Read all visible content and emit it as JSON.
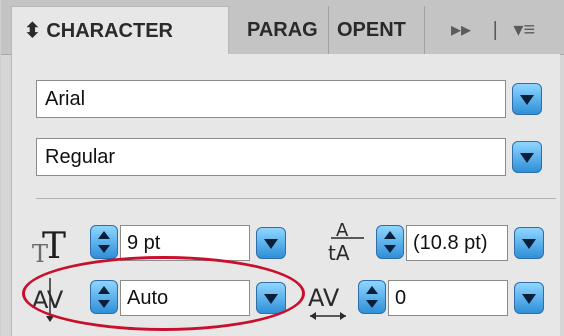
{
  "tabs": [
    {
      "label": "⬍ CHARACTER"
    },
    {
      "label": "PARAG"
    },
    {
      "label": "OPENT"
    }
  ],
  "tab_icons": {
    "expand": "▸▸",
    "divider": "|",
    "menu": "▾≡"
  },
  "font": {
    "family": "Arial",
    "style": "Regular"
  },
  "size": {
    "value": "9 pt",
    "icon_text": "T"
  },
  "leading": {
    "value": "(10.8 pt)"
  },
  "kerning": {
    "value": "Auto"
  },
  "tracking": {
    "value": "0"
  },
  "colors": {
    "accent_blue": "#2e8fd8",
    "highlight_red": "#c8102e"
  }
}
